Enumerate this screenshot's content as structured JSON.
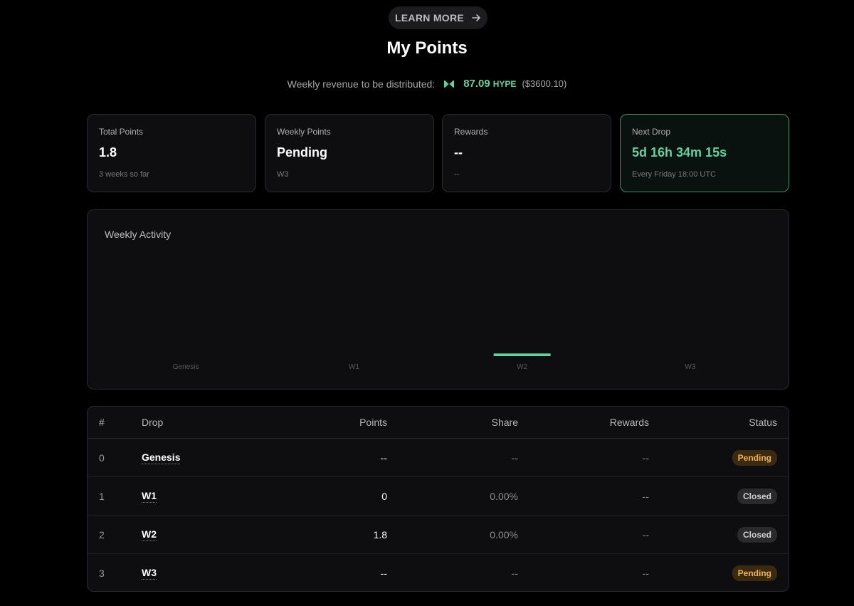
{
  "header": {
    "learn_more_label": "LEARN MORE",
    "title": "My Points"
  },
  "revenue": {
    "label": "Weekly revenue to be distributed:",
    "amount": "87.09",
    "unit": "HYPE",
    "usd": "($3600.10)"
  },
  "cards": [
    {
      "label": "Total Points",
      "value": "1.8",
      "sub": "3 weeks so far"
    },
    {
      "label": "Weekly Points",
      "value": "Pending",
      "sub": "W3"
    },
    {
      "label": "Rewards",
      "value": "--",
      "sub": "--"
    },
    {
      "label": "Next Drop",
      "value": "5d 16h 34m 15s",
      "sub": "Every Friday 18:00 UTC"
    }
  ],
  "activity": {
    "title": "Weekly Activity"
  },
  "chart_data": {
    "type": "bar",
    "title": "Weekly Activity",
    "categories": [
      "Genesis",
      "W1",
      "W2",
      "W3"
    ],
    "values": [
      null,
      0,
      1.8,
      null
    ]
  },
  "table": {
    "headers": {
      "idx": "#",
      "drop": "Drop",
      "points": "Points",
      "share": "Share",
      "rewards": "Rewards",
      "status": "Status"
    },
    "rows": [
      {
        "idx": "0",
        "drop": "Genesis",
        "points": "--",
        "share": "--",
        "rewards": "--",
        "status": "Pending"
      },
      {
        "idx": "1",
        "drop": "W1",
        "points": "0",
        "share": "0.00%",
        "rewards": "--",
        "status": "Closed"
      },
      {
        "idx": "2",
        "drop": "W2",
        "points": "1.8",
        "share": "0.00%",
        "rewards": "--",
        "status": "Closed"
      },
      {
        "idx": "3",
        "drop": "W3",
        "points": "--",
        "share": "--",
        "rewards": "--",
        "status": "Pending"
      }
    ]
  },
  "colors": {
    "accent_green": "#5fd3a0",
    "pending_badge": "#f0b24a",
    "closed_badge": "#cfcfcf"
  },
  "icons": {
    "learn_more": "arrow-right-icon",
    "revenue": "hype-logo-icon"
  }
}
